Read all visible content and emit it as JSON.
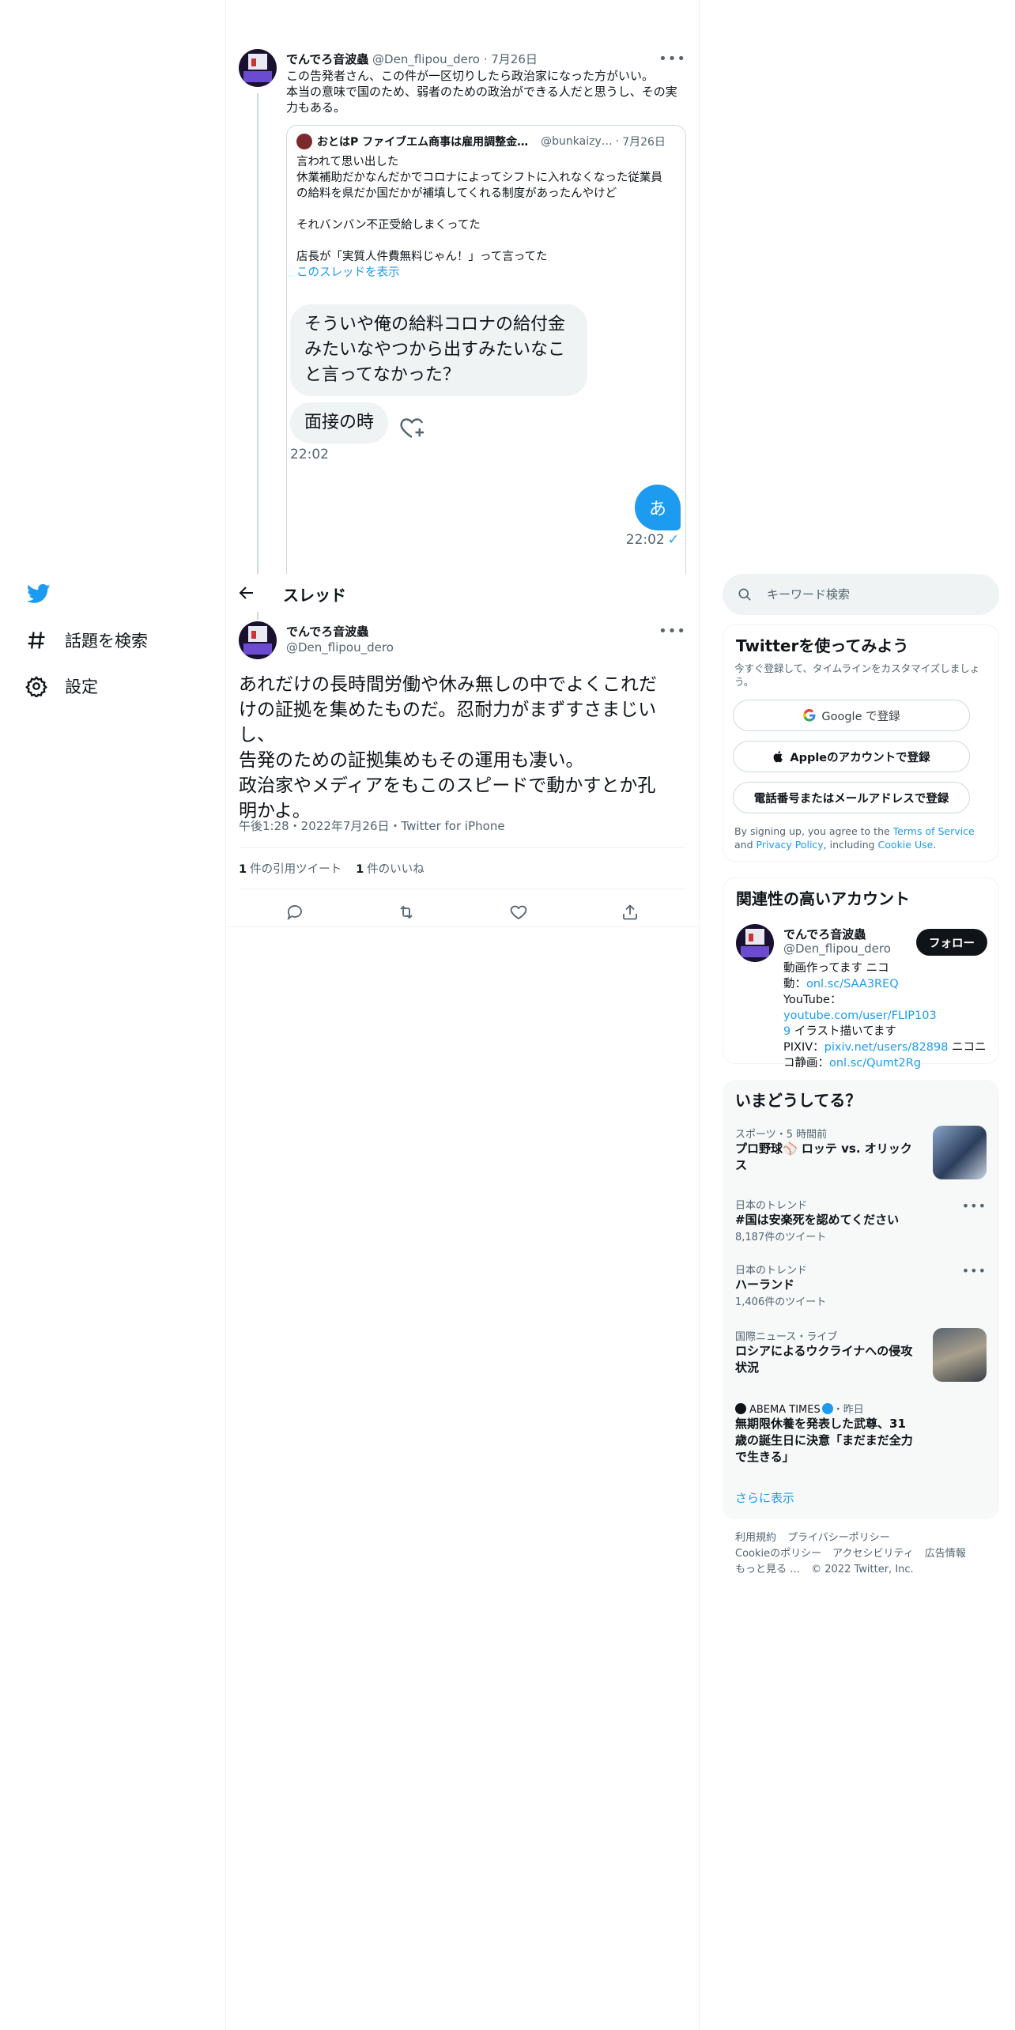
{
  "left_nav": {
    "logo": "twitter-bird-icon",
    "items": [
      {
        "label": "話題を検索",
        "icon": "hashtag-icon"
      },
      {
        "label": "設定",
        "icon": "gear-icon"
      }
    ]
  },
  "quoted_tweet": {
    "name": "でんでろ音波蟲",
    "handle": "@Den_flipou_dero",
    "date": "7月26日",
    "text_lines": [
      "この告発者さん、この件が一区切りしたら政治家になった方がいい。",
      "本当の意味で国のため、弱者のための政治ができる人だと思うし、その実",
      "力もある。"
    ],
    "inner_quote": {
      "name": "おとはP ファイブエム商事は雇用調整金…",
      "handle": "@bunkaizy…",
      "date": "7月26日",
      "lines": [
        "言われて思い出した",
        "休業補助だかなんだかでコロナによってシフトに入れなくなった従業員",
        "の給料を県だか国だかが補填してくれる制度があったんやけど",
        "",
        "それバンバン不正受給しまくってた",
        "",
        "店長が「実質人件費無料じゃん！」って言ってた"
      ],
      "show_thread": "このスレッドを表示",
      "chat": {
        "bubble1": "そういや俺の給料コロナの給付金みたいなやつから出すみたいなこと言ってなかった？",
        "bubble2": "面接の時",
        "time_left": "22:02",
        "bubble_right": "あ",
        "time_right": "22:02",
        "check": "✓"
      }
    }
  },
  "header": {
    "title": "スレッド"
  },
  "main_tweet": {
    "name": "でんでろ音波蟲",
    "handle": "@Den_flipou_dero",
    "text_lines": [
      "あれだけの長時間労働や休み無しの中でよくこれだ",
      "けの証拠を集めたものだ。忍耐力がまずすさまじい",
      "し、",
      "告発のための証拠集めもその運用も凄い。",
      "政治家やメディアをもこのスピードで動かすとか孔",
      "明かよ。"
    ],
    "meta": "午後1:28・2022年7月26日・Twitter for iPhone",
    "quote_count": "1",
    "quote_label": "件の引用ツイート",
    "like_count": "1",
    "like_label": "件のいいね"
  },
  "sidebar": {
    "search_placeholder": "キーワード検索",
    "signup": {
      "title": "Twitterを使ってみよう",
      "subtitle": "今すぐ登録して、タイムラインをカスタマイズしましょう。",
      "google": "Google で登録",
      "apple": "Appleのアカウントで登録",
      "phone": "電話番号またはメールアドレスで登録",
      "terms_pre": "By signing up, you agree to the ",
      "terms_tos": "Terms of Service",
      "terms_and": " and ",
      "terms_privacy": "Privacy Policy",
      "terms_mid": ", including ",
      "terms_cookie": "Cookie Use",
      "terms_end": "."
    },
    "related": {
      "title": "関連性の高いアカウント",
      "name": "でんでろ音波蟲",
      "handle": "@Den_flipou_dero",
      "follow": "フォロー",
      "bio_1": "動画作ってます ニコ",
      "bio_2": "動：",
      "bio_link1": "onl.sc/SAA3REQ",
      "bio_3": "YouTube：",
      "bio_link2": "youtube.com/user/FLIP103",
      "bio_link2b": "9",
      "bio_4": " イラスト描いてます",
      "bio_5": "PIXIV：",
      "bio_link3": "pixiv.net/users/82898",
      "bio_6": " ニコニ",
      "bio_7": "コ静画：",
      "bio_link4": "onl.sc/Qumt2Rg"
    },
    "trends": {
      "title": "いまどうしてる？",
      "items": [
        {
          "category": "スポーツ・5 時間前",
          "title": "プロ野球⚾ ロッテ vs. オリックス",
          "count": ""
        },
        {
          "category": "日本のトレンド",
          "title": "#国は安楽死を認めてください",
          "count": "8,187件のツイート"
        },
        {
          "category": "日本のトレンド",
          "title": "ハーランド",
          "count": "1,406件のツイート"
        },
        {
          "category": "国際ニュース・ライブ",
          "title": "ロシアによるウクライナへの侵攻状況",
          "count": ""
        },
        {
          "category_source": "ABEMA TIMES",
          "category_time": "・昨日",
          "title": "無期限休養を発表した武尊、31歳の誕生日に決意「まだまだ全力で生きる」",
          "count": ""
        }
      ],
      "show_more": "さらに表示"
    },
    "footer": {
      "links": [
        "利用規約",
        "プライバシーポリシー",
        "Cookieのポリシー",
        "アクセシビリティ",
        "広告情報",
        "もっと見る …"
      ],
      "copyright": "© 2022 Twitter, Inc."
    }
  },
  "colors": {
    "accent": "#1d9bf0",
    "text": "#0f1419",
    "muted": "#536471",
    "border": "#eff3f4"
  }
}
